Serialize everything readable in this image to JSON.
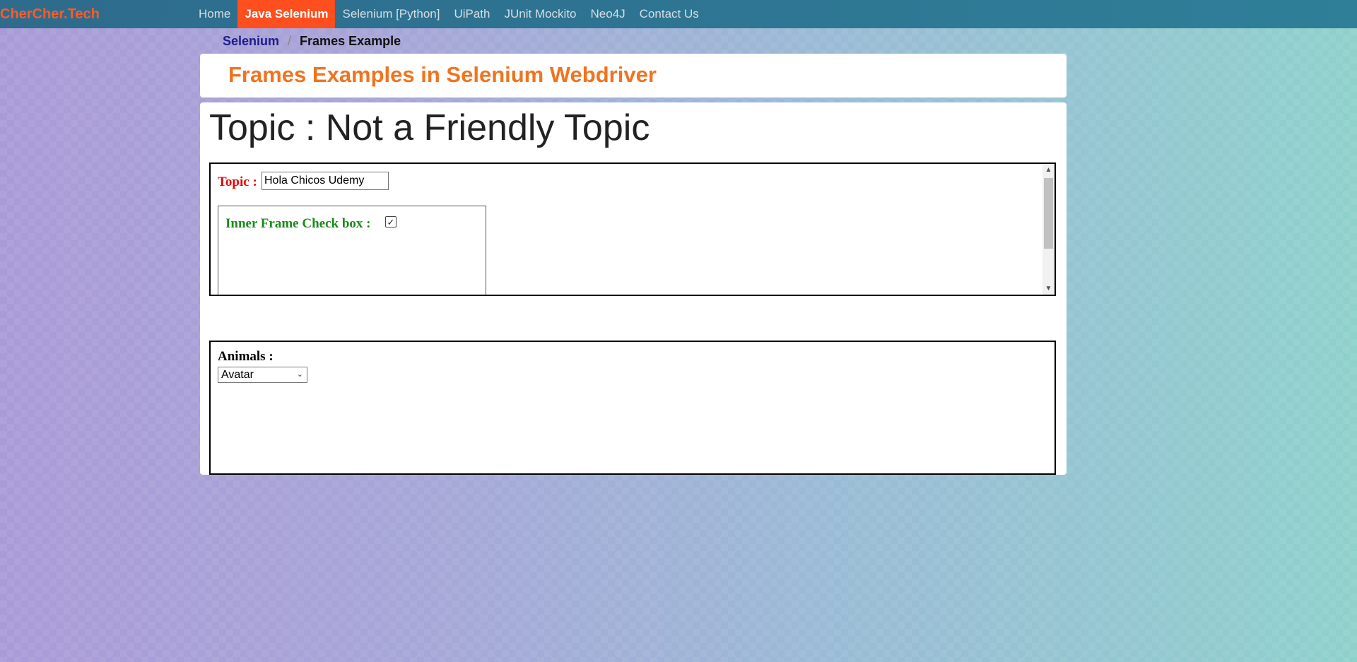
{
  "navbar": {
    "brand": "CherCher.Tech",
    "items": [
      "Home",
      "Java Selenium",
      "Selenium [Python]",
      "UiPath",
      "JUnit Mockito",
      "Neo4J",
      "Contact Us"
    ],
    "active_item": "Java Selenium"
  },
  "breadcrumb": {
    "link": "Selenium",
    "separator": "/",
    "current": "Frames Example"
  },
  "header": {
    "title": "Frames Examples in Selenium Webdriver"
  },
  "main": {
    "heading": "Topic : Not a Friendly Topic",
    "frame1": {
      "label": "Topic :",
      "input_value": "Hola Chicos Udemy",
      "inner_frame": {
        "label": "Inner Frame Check box :",
        "checked": true,
        "check_glyph": "✓"
      }
    },
    "frame2": {
      "label": "Animals :",
      "selected": "Avatar"
    }
  },
  "colors": {
    "accent": "#ff4f1f",
    "header_title": "#f0741f",
    "topic_label": "#ee0000",
    "inner_label": "#1a8a1a"
  }
}
